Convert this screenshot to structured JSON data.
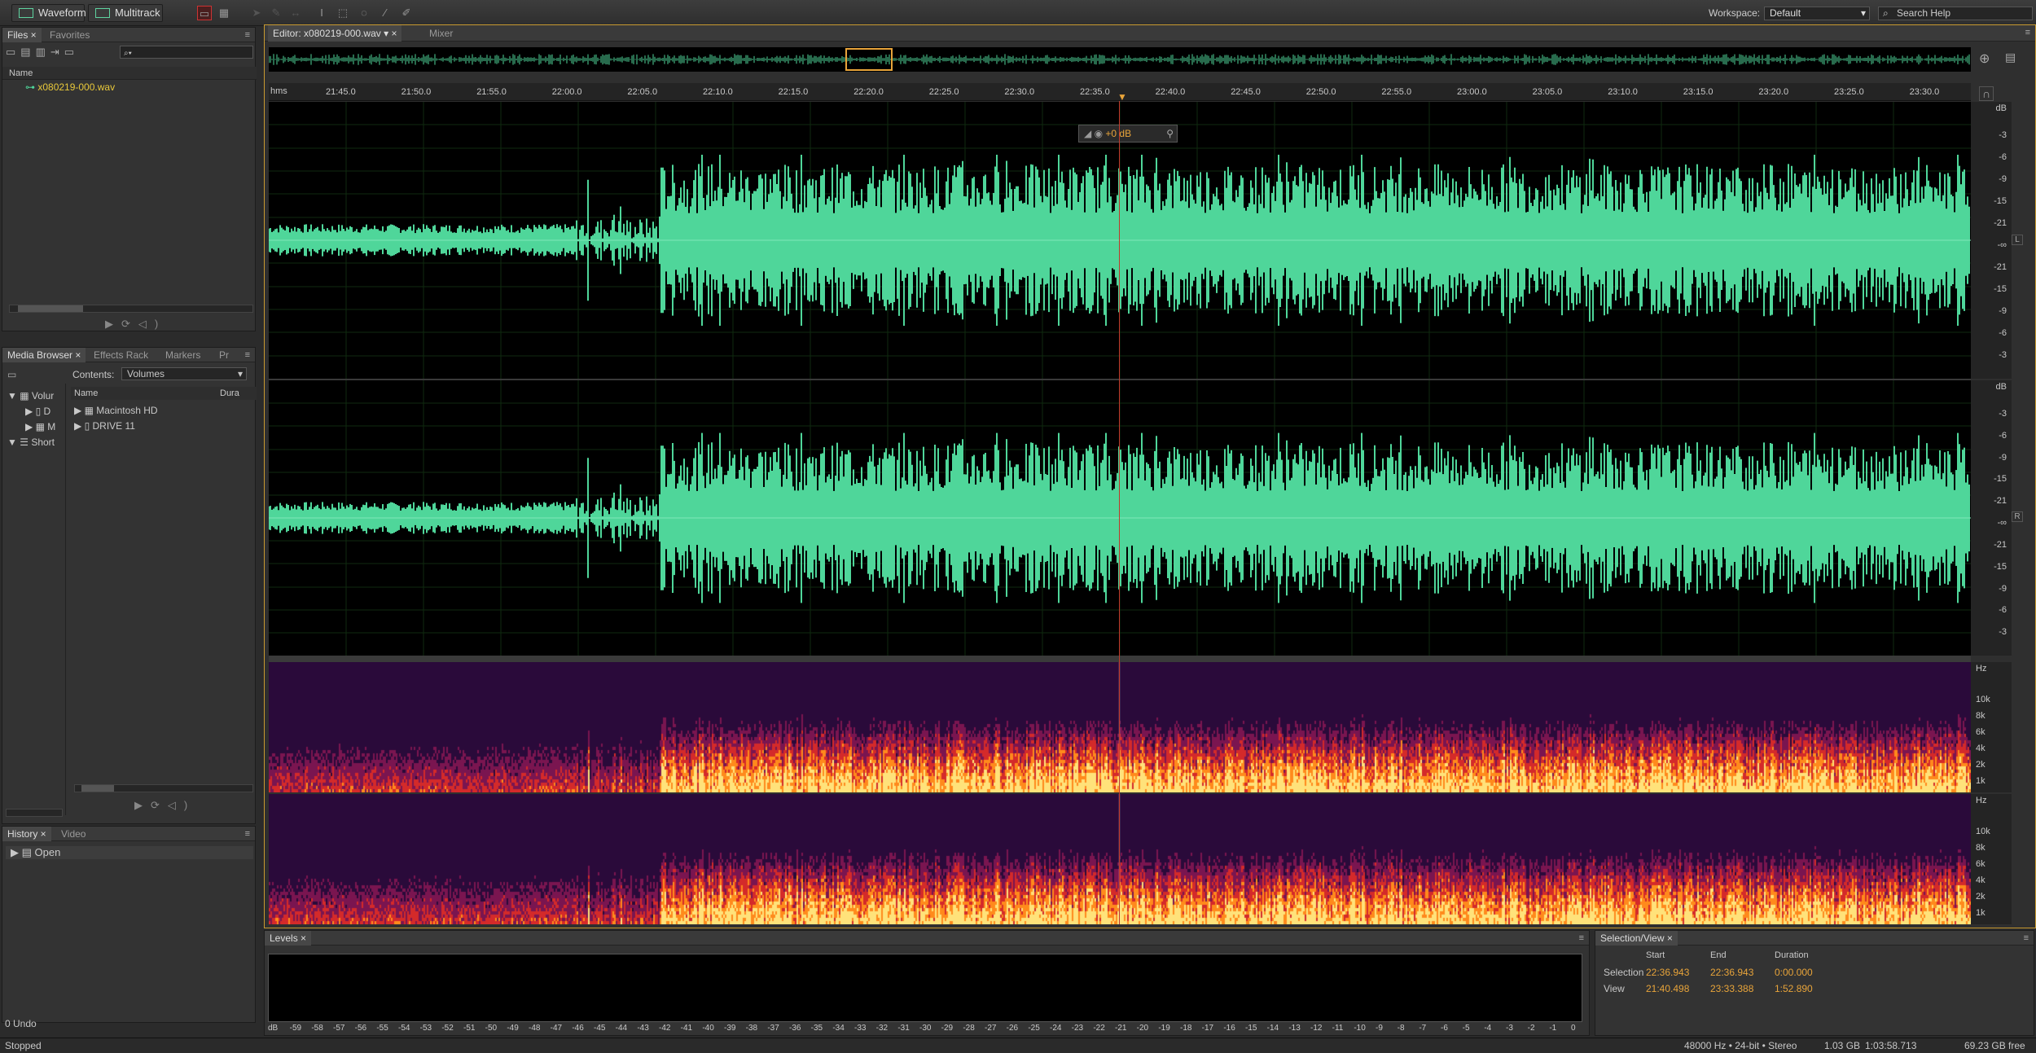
{
  "toolbar": {
    "waveform": "Waveform",
    "multitrack": "Multitrack",
    "workspace_label": "Workspace:",
    "workspace_value": "Default",
    "search_placeholder": "Search Help"
  },
  "files": {
    "tab_files": "Files",
    "tab_favorites": "Favorites",
    "col_name": "Name",
    "file": "x080219-000.wav"
  },
  "media": {
    "tab_media": "Media Browser",
    "tab_effects": "Effects Rack",
    "tab_markers": "Markers",
    "tab_fx": "Pr",
    "contents_label": "Contents:",
    "contents_value": "Volumes",
    "col_name": "Name",
    "col_dur": "Dura",
    "tree_volumes": "Volur",
    "tree_d": "D",
    "tree_m": "M",
    "tree_short": "Short",
    "item1": "Macintosh HD",
    "item2": "DRIVE 11"
  },
  "history": {
    "tab_history": "History",
    "tab_video": "Video",
    "item": "Open",
    "undo": "0 Undo"
  },
  "editor": {
    "tab_editor": "Editor: x080219-000.wav",
    "tab_mixer": "Mixer",
    "hms": "hms",
    "ticks": [
      "21:45.0",
      "21:50.0",
      "21:55.0",
      "22:00.0",
      "22:05.0",
      "22:10.0",
      "22:15.0",
      "22:20.0",
      "22:25.0",
      "22:30.0",
      "22:35.0",
      "22:40.0",
      "22:45.0",
      "22:50.0",
      "22:55.0",
      "23:00.0",
      "23:05.0",
      "23:10.0",
      "23:15.0",
      "23:20.0",
      "23:25.0",
      "23:30.0"
    ],
    "hud_gain": "+0 dB",
    "db_labels": [
      "dB",
      "-3",
      "-6",
      "-9",
      "-15",
      "-21",
      "-∞",
      "-21",
      "-15",
      "-9",
      "-6",
      "-3"
    ],
    "hz_labels": [
      "Hz",
      "10k",
      "8k",
      "6k",
      "4k",
      "2k",
      "1k"
    ],
    "ch_l": "L",
    "ch_r": "R"
  },
  "levels": {
    "tab": "Levels",
    "scale": [
      "dB",
      "-59",
      "-58",
      "-57",
      "-56",
      "-55",
      "-54",
      "-53",
      "-52",
      "-51",
      "-50",
      "-49",
      "-48",
      "-47",
      "-46",
      "-45",
      "-44",
      "-43",
      "-42",
      "-41",
      "-40",
      "-39",
      "-38",
      "-37",
      "-36",
      "-35",
      "-34",
      "-33",
      "-32",
      "-31",
      "-30",
      "-29",
      "-28",
      "-27",
      "-26",
      "-25",
      "-24",
      "-23",
      "-22",
      "-21",
      "-20",
      "-19",
      "-18",
      "-17",
      "-16",
      "-15",
      "-14",
      "-13",
      "-12",
      "-11",
      "-10",
      "-9",
      "-8",
      "-7",
      "-6",
      "-5",
      "-4",
      "-3",
      "-2",
      "-1",
      "0"
    ]
  },
  "selview": {
    "tab": "Selection/View",
    "h_start": "Start",
    "h_end": "End",
    "h_dur": "Duration",
    "sel_label": "Selection",
    "sel_start": "22:36.943",
    "sel_end": "22:36.943",
    "sel_dur": "0:00.000",
    "view_label": "View",
    "view_start": "21:40.498",
    "view_end": "23:33.388",
    "view_dur": "1:52.890"
  },
  "status": {
    "left": "Stopped",
    "format": "48000 Hz • 24-bit • Stereo",
    "size": "1.03 GB",
    "dur": "1:03:58.713",
    "free": "69.23 GB free"
  },
  "colors": {
    "wave": "#4fd69a",
    "accent": "#e8a43a"
  }
}
